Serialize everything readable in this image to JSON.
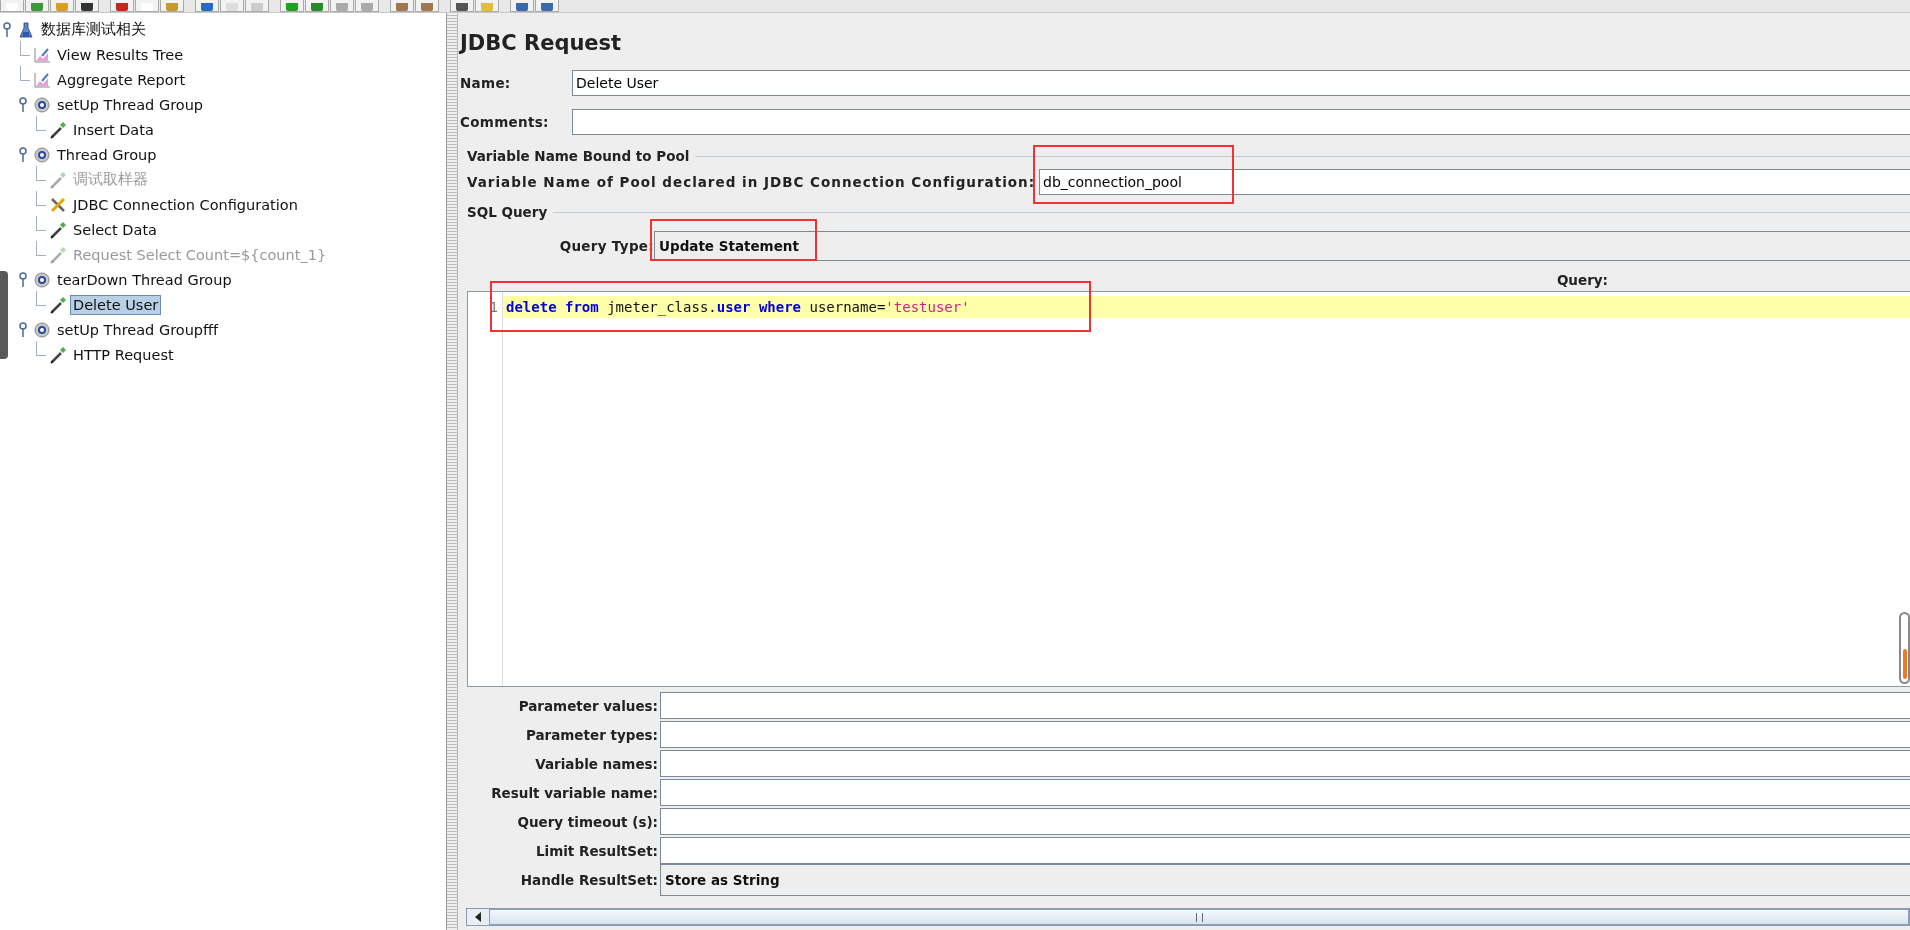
{
  "tree": [
    {
      "label": "数据库测试相关",
      "kind": "testplan",
      "expanded": true,
      "selected": false,
      "disabled": false,
      "children": [
        {
          "label": "View Results Tree",
          "kind": "listener",
          "selected": false,
          "disabled": false
        },
        {
          "label": "Aggregate Report",
          "kind": "listener",
          "selected": false,
          "disabled": false
        },
        {
          "label": "setUp Thread Group",
          "kind": "threadgroup",
          "expanded": true,
          "selected": false,
          "disabled": false,
          "children": [
            {
              "label": "Insert Data",
              "kind": "sampler",
              "selected": false,
              "disabled": false
            }
          ]
        },
        {
          "label": "Thread Group",
          "kind": "threadgroup",
          "expanded": true,
          "selected": false,
          "disabled": false,
          "children": [
            {
              "label": "调试取样器",
              "kind": "sampler",
              "selected": false,
              "disabled": true
            },
            {
              "label": "JDBC Connection Configuration",
              "kind": "config",
              "selected": false,
              "disabled": false
            },
            {
              "label": "Select Data",
              "kind": "sampler",
              "selected": false,
              "disabled": false
            },
            {
              "label": "Request Select Count=${count_1}",
              "kind": "sampler",
              "selected": false,
              "disabled": true
            }
          ]
        },
        {
          "label": "tearDown Thread Group",
          "kind": "threadgroup",
          "expanded": true,
          "selected": false,
          "disabled": false,
          "children": [
            {
              "label": "Delete User",
              "kind": "sampler",
              "selected": true,
              "disabled": false
            }
          ]
        },
        {
          "label": "setUp Thread Groupfff",
          "kind": "threadgroup",
          "expanded": true,
          "selected": false,
          "disabled": false,
          "children": [
            {
              "label": "HTTP Request",
              "kind": "sampler",
              "selected": false,
              "disabled": false
            }
          ]
        }
      ]
    }
  ],
  "panel": {
    "title": "JDBC Request",
    "name": {
      "label": "Name:",
      "value": "Delete User"
    },
    "comments": {
      "label": "Comments:"
    },
    "pool": {
      "legend": "Variable Name Bound to Pool",
      "label": "Variable Name of Pool declared in JDBC Connection Configuration:",
      "value": "db_connection_pool",
      "annotated": true
    },
    "sql": {
      "legend": "SQL Query",
      "query_type_label": "Query Type:",
      "query_type": "Update Statement",
      "query_type_annotated": true,
      "query_header": "Query:",
      "lines": [
        {
          "number": "1",
          "current": true,
          "annotated": true,
          "tokens": [
            {
              "text": "delete",
              "kind": "keyword"
            },
            {
              "text": " from",
              "kind": "keyword"
            },
            {
              "text": " jmeter_class.",
              "kind": "plain"
            },
            {
              "text": "user",
              "kind": "keyword"
            },
            {
              "text": " where",
              "kind": "keyword"
            },
            {
              "text": " username=",
              "kind": "plain"
            },
            {
              "text": "'testuser'",
              "kind": "string"
            }
          ]
        }
      ]
    },
    "params": [
      {
        "label": "Parameter values:",
        "kind": "text"
      },
      {
        "label": "Parameter types:",
        "kind": "text"
      },
      {
        "label": "Variable names:",
        "kind": "text"
      },
      {
        "label": "Result variable name:",
        "kind": "text"
      },
      {
        "label": "Query timeout (s):",
        "kind": "text"
      },
      {
        "label": "Limit ResultSet:",
        "kind": "text"
      },
      {
        "label": "Handle ResultSet:",
        "kind": "combo",
        "value": "Store as String"
      }
    ]
  }
}
